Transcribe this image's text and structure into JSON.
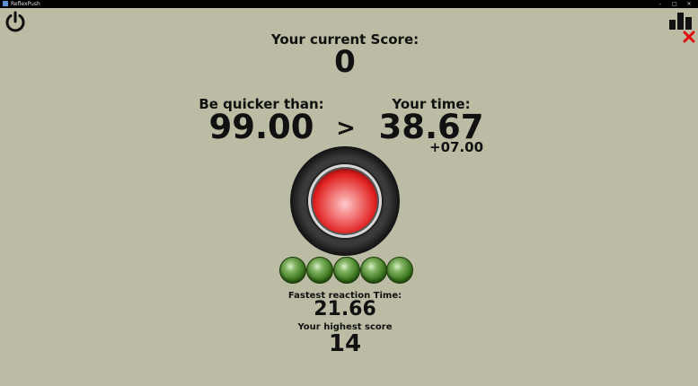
{
  "window": {
    "title": "ReflexPush",
    "controls": [
      "–",
      "□",
      "✕"
    ]
  },
  "toolbar": {
    "power_icon": "power-icon",
    "leaderboard_icon": "bar-chart-icon",
    "close_icon": "close-icon",
    "close_color": "#e01010"
  },
  "score": {
    "label": "Your current Score:",
    "value": "0"
  },
  "target": {
    "label": "Be quicker than:",
    "value": "99.00"
  },
  "comparison": {
    "symbol": ">"
  },
  "time": {
    "label": "Your time:",
    "value": "38.67",
    "delta": "+07.00"
  },
  "button": {
    "color": "#e02020"
  },
  "lights": {
    "count": 5,
    "color": "#3d7a20"
  },
  "stats": {
    "fastest_label": "Fastest reaction Time:",
    "fastest_value": "21.66",
    "highest_label": "Your highest score",
    "highest_value": "14"
  }
}
